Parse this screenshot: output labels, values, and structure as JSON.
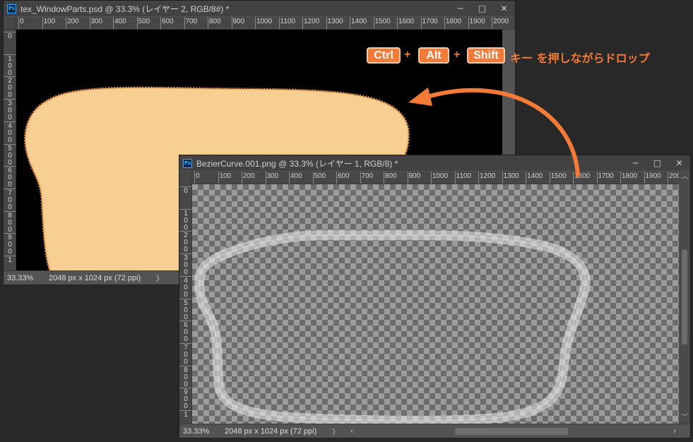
{
  "window_back": {
    "title": "tex_WindowParts.psd @ 33.3% (レイヤー 2, RGB/8#) *",
    "ps_icon": "Ps",
    "controls": {
      "minimize": "─",
      "restore": "□",
      "close": "✕"
    },
    "ruler_h": [
      "0",
      "100",
      "200",
      "300",
      "400",
      "500",
      "600",
      "700",
      "800",
      "900",
      "1000",
      "1100",
      "1200",
      "1300",
      "1400",
      "1500",
      "1600",
      "1700",
      "1800",
      "1900",
      "2000"
    ],
    "ruler_v": [
      [
        "0"
      ],
      [
        "1",
        "0",
        "0"
      ],
      [
        "2",
        "0",
        "0"
      ],
      [
        "3",
        "0",
        "0"
      ],
      [
        "4",
        "0",
        "0"
      ],
      [
        "5",
        "0",
        "0"
      ],
      [
        "6",
        "0",
        "0"
      ],
      [
        "7",
        "0",
        "0"
      ],
      [
        "8",
        "0",
        "0"
      ],
      [
        "9",
        "0",
        "0"
      ],
      [
        "1"
      ]
    ],
    "zoom": "33.33%",
    "doc_size": "2048 px x 1024 px (72 ppi)",
    "status_arrow": "〉",
    "canvas_color": "#000000",
    "shape_fill": "#f8cf92",
    "shape_outline": "#e7903f"
  },
  "window_front": {
    "title": "BezierCurve.001.png @ 33.3% (レイヤー 1, RGB/8) *",
    "ps_icon": "Ps",
    "controls": {
      "minimize": "─",
      "restore": "□",
      "close": "✕"
    },
    "ruler_h": [
      "0",
      "100",
      "200",
      "300",
      "400",
      "500",
      "600",
      "700",
      "800",
      "900",
      "1000",
      "1100",
      "1200",
      "1300",
      "1400",
      "1500",
      "1600",
      "1700",
      "1800",
      "1900",
      "200"
    ],
    "ruler_v": [
      [
        "0"
      ],
      [
        "1",
        "0",
        "0"
      ],
      [
        "2",
        "0",
        "0"
      ],
      [
        "3",
        "0",
        "0"
      ],
      [
        "4",
        "0",
        "0"
      ],
      [
        "5",
        "0",
        "0"
      ],
      [
        "6",
        "0",
        "0"
      ],
      [
        "7",
        "0",
        "0"
      ],
      [
        "8",
        "0",
        "0"
      ],
      [
        "9",
        "0",
        "0"
      ],
      [
        "1"
      ]
    ],
    "zoom": "33.33%",
    "doc_size": "2048 px x 1024 px (72 ppi)",
    "status_arrow": "〉",
    "hscroll_left": "‹",
    "hscroll_right": "›",
    "vscroll_up": "︿",
    "vscroll_down": "﹀"
  },
  "instruction": {
    "keys": [
      "Ctrl",
      "Alt",
      "Shift"
    ],
    "plus": "+",
    "text": "キー を押しながらドロップ",
    "accent": "#f47a37"
  }
}
